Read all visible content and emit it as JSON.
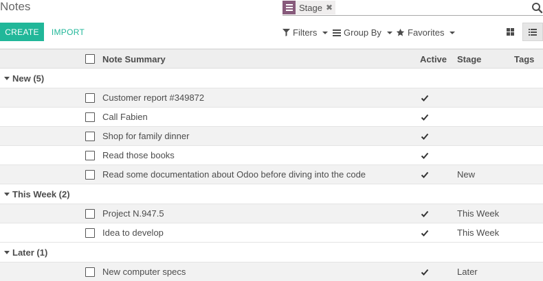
{
  "app": {
    "title": "Notes"
  },
  "search": {
    "facet_label": "Stage",
    "facet_remove": "✖",
    "placeholder": ""
  },
  "toolbar": {
    "create_label": "CREATE",
    "import_label": "IMPORT",
    "filters_label": "Filters",
    "groupby_label": "Group By",
    "favorites_label": "Favorites"
  },
  "columns": {
    "summary": "Note Summary",
    "active": "Active",
    "stage": "Stage",
    "tags": "Tags"
  },
  "groups": [
    {
      "label": "New (5)",
      "rows": [
        {
          "summary": "Customer report #349872",
          "active": true,
          "stage": ""
        },
        {
          "summary": "Call Fabien",
          "active": true,
          "stage": ""
        },
        {
          "summary": "Shop for family dinner",
          "active": true,
          "stage": ""
        },
        {
          "summary": "Read those books",
          "active": true,
          "stage": ""
        },
        {
          "summary": "Read some documentation about Odoo before diving into the code",
          "active": true,
          "stage": "New"
        }
      ]
    },
    {
      "label": "This Week (2)",
      "rows": [
        {
          "summary": "Project N.947.5",
          "active": true,
          "stage": "This Week"
        },
        {
          "summary": "Idea to develop",
          "active": true,
          "stage": "This Week"
        }
      ]
    },
    {
      "label": "Later (1)",
      "rows": [
        {
          "summary": "New computer specs",
          "active": true,
          "stage": "Later"
        }
      ]
    }
  ],
  "colors": {
    "accent": "#21b799",
    "facet": "#875a7b"
  }
}
